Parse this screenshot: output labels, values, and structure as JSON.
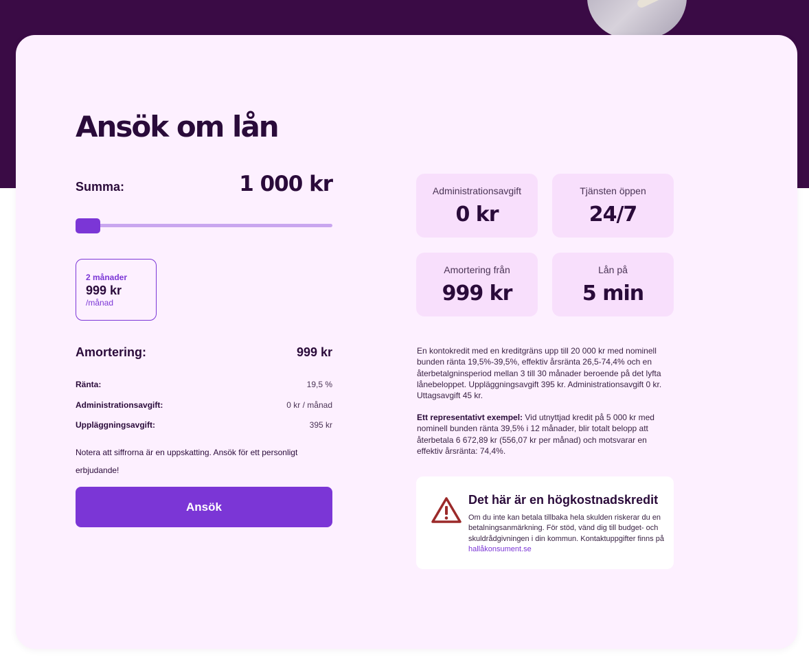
{
  "title": "Ansök om lån",
  "calculator": {
    "sum_label": "Summa:",
    "sum_value": "1 000 kr",
    "slider_fraction": 0
  },
  "term": {
    "months": "2 månader",
    "amount": "999 kr",
    "unit": "/månad"
  },
  "amortization": {
    "label": "Amortering:",
    "value": "999 kr"
  },
  "details": [
    {
      "label": "Ränta:",
      "value": "19,5 %"
    },
    {
      "label": "Administrationsavgift:",
      "value": "0 kr / månad"
    },
    {
      "label": "Uppläggningsavgift:",
      "value": "395 kr"
    }
  ],
  "note": "Notera att siffrorna är en uppskatting. Ansök för ett personligt erbjudande!",
  "apply_label": "Ansök",
  "stats": [
    {
      "label": "Administrationsavgift",
      "value": "0 kr"
    },
    {
      "label": "Tjänsten öppen",
      "value": "24/7"
    },
    {
      "label": "Amortering från",
      "value": "999 kr"
    },
    {
      "label": "Lån på",
      "value": "5 min"
    }
  ],
  "terms_text": "En kontokredit med en kreditgräns upp till 20 000 kr med nominell bunden ränta 19,5%-39,5%, effektiv årsränta 26,5-74,4% och en återbetalgninsperiod mellan 3 till 30 månader beroende på det lyfta lånebeloppet. Uppläggningsavgift 395 kr. Administrationsavgift 0 kr. Uttagsavgift 45 kr.",
  "example": {
    "label": "Ett representativt exempel:",
    "text": " Vid utnyttjad kredit på 5 000 kr med nominell bunden ränta 39,5% i 12 månader, blir totalt belopp att återbetala 6 672,89 kr (556,07 kr per månad) och motsvarar en effektiv årsränta: 74,4%."
  },
  "warning": {
    "icon": "warning-triangle-icon",
    "title": "Det här är en högkostnadskredit",
    "body": "Om du inte kan betala tillbaka hela skulden riskerar du en betalningsanmärkning. För stöd, vänd dig till budget- och skuldrådgivningen i din kommun. Kontaktuppgifter finns på ",
    "link_text": "hallåkonsument.se"
  },
  "colors": {
    "band": "#3a0b45",
    "card": "#fdf0ff",
    "accent": "#7b36d6",
    "tile": "#f8dffc",
    "warning": "#9b2a2a"
  }
}
